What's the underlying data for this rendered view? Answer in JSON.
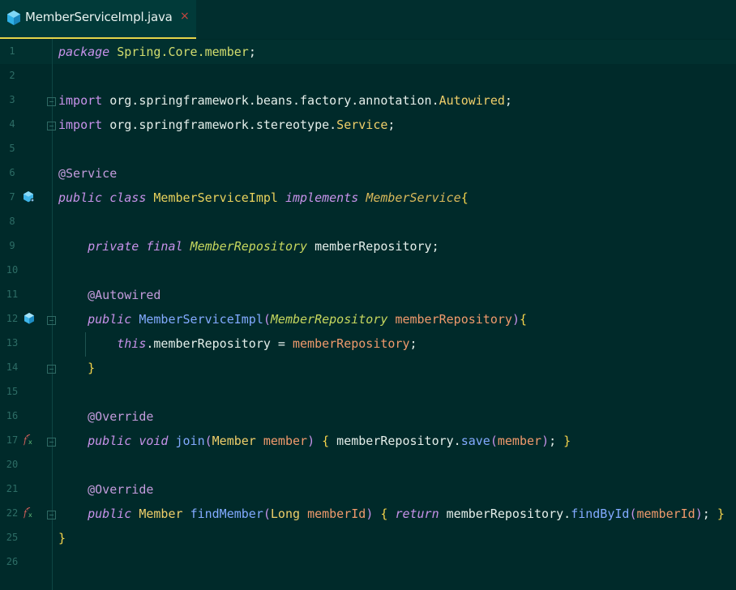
{
  "tab": {
    "title": "MemberServiceImpl.java",
    "close": "×",
    "icon": "java-class-icon"
  },
  "lines": [
    {
      "n": "1",
      "tokens": [
        [
          "kw",
          "package"
        ],
        [
          "pn",
          " "
        ],
        [
          "pk",
          "Spring.Core.member"
        ],
        [
          "pn",
          ";"
        ]
      ]
    },
    {
      "n": "2",
      "tokens": []
    },
    {
      "n": "3",
      "fold": true,
      "tokens": [
        [
          "imp",
          "import"
        ],
        [
          "pn",
          " org.springframework.beans.factory.annotation."
        ],
        [
          "cls",
          "Autowired"
        ],
        [
          "pn",
          ";"
        ]
      ]
    },
    {
      "n": "4",
      "fold": true,
      "tokens": [
        [
          "imp",
          "import"
        ],
        [
          "pn",
          " org.springframework.stereotype."
        ],
        [
          "cls",
          "Service"
        ],
        [
          "pn",
          ";"
        ]
      ]
    },
    {
      "n": "5",
      "tokens": []
    },
    {
      "n": "6",
      "tokens": [
        [
          "an",
          "@Service"
        ]
      ]
    },
    {
      "n": "7",
      "icon": "implementation-icon",
      "tokens": [
        [
          "kw",
          "public"
        ],
        [
          "pn",
          " "
        ],
        [
          "kw",
          "class"
        ],
        [
          "pn",
          " "
        ],
        [
          "yl",
          "MemberServiceImpl"
        ],
        [
          "pn",
          " "
        ],
        [
          "kw",
          "implements"
        ],
        [
          "pn",
          " "
        ],
        [
          "iface",
          "MemberService"
        ],
        [
          "br",
          "{"
        ]
      ]
    },
    {
      "n": "8",
      "tokens": []
    },
    {
      "n": "9",
      "tokens": [
        [
          "pn",
          "    "
        ],
        [
          "kw",
          "private"
        ],
        [
          "pn",
          " "
        ],
        [
          "kw",
          "final"
        ],
        [
          "pn",
          " "
        ],
        [
          "tp",
          "MemberRepository"
        ],
        [
          "pn",
          " memberRepository;"
        ]
      ]
    },
    {
      "n": "10",
      "tokens": []
    },
    {
      "n": "11",
      "tokens": [
        [
          "pn",
          "    "
        ],
        [
          "an",
          "@Autowired"
        ]
      ]
    },
    {
      "n": "12",
      "icon": "bean-icon",
      "fold": true,
      "tokens": [
        [
          "pn",
          "    "
        ],
        [
          "kw",
          "public"
        ],
        [
          "pn",
          " "
        ],
        [
          "fn",
          "MemberServiceImpl"
        ],
        [
          "br2",
          "("
        ],
        [
          "tp",
          "MemberRepository"
        ],
        [
          "pn",
          " "
        ],
        [
          "par",
          "memberRepository"
        ],
        [
          "br2",
          ")"
        ],
        [
          "br",
          "{"
        ]
      ]
    },
    {
      "n": "13",
      "tokens": [
        [
          "pn",
          "        "
        ],
        [
          "kw",
          "this"
        ],
        [
          "pn",
          ".memberRepository = "
        ],
        [
          "par",
          "memberRepository"
        ],
        [
          "pn",
          ";"
        ]
      ]
    },
    {
      "n": "14",
      "fold": true,
      "tokens": [
        [
          "pn",
          "    "
        ],
        [
          "br",
          "}"
        ]
      ]
    },
    {
      "n": "15",
      "tokens": []
    },
    {
      "n": "16",
      "tokens": [
        [
          "pn",
          "    "
        ],
        [
          "an",
          "@Override"
        ]
      ]
    },
    {
      "n": "17",
      "icon": "override-icon",
      "fold": true,
      "tokens": [
        [
          "pn",
          "    "
        ],
        [
          "kw",
          "public"
        ],
        [
          "pn",
          " "
        ],
        [
          "kw",
          "void"
        ],
        [
          "pn",
          " "
        ],
        [
          "fn",
          "join"
        ],
        [
          "br2",
          "("
        ],
        [
          "cls",
          "Member"
        ],
        [
          "pn",
          " "
        ],
        [
          "par",
          "member"
        ],
        [
          "br2",
          ")"
        ],
        [
          "pn",
          " "
        ],
        [
          "br",
          "{"
        ],
        [
          "pn",
          " memberRepository."
        ],
        [
          "fn",
          "save"
        ],
        [
          "br2",
          "("
        ],
        [
          "par",
          "member"
        ],
        [
          "br2",
          ")"
        ],
        [
          "pn",
          ";"
        ],
        [
          "pn",
          " "
        ],
        [
          "br",
          "}"
        ]
      ]
    },
    {
      "n": "20",
      "tokens": []
    },
    {
      "n": "21",
      "tokens": [
        [
          "pn",
          "    "
        ],
        [
          "an",
          "@Override"
        ]
      ]
    },
    {
      "n": "22",
      "icon": "override-icon",
      "fold": true,
      "tokens": [
        [
          "pn",
          "    "
        ],
        [
          "kw",
          "public"
        ],
        [
          "pn",
          " "
        ],
        [
          "cls",
          "Member"
        ],
        [
          "pn",
          " "
        ],
        [
          "fn",
          "findMember"
        ],
        [
          "br2",
          "("
        ],
        [
          "cls",
          "Long"
        ],
        [
          "pn",
          " "
        ],
        [
          "par",
          "memberId"
        ],
        [
          "br2",
          ")"
        ],
        [
          "pn",
          " "
        ],
        [
          "br",
          "{"
        ],
        [
          "pn",
          " "
        ],
        [
          "kw",
          "return"
        ],
        [
          "pn",
          " memberRepository."
        ],
        [
          "fn",
          "findById"
        ],
        [
          "br2",
          "("
        ],
        [
          "par",
          "memberId"
        ],
        [
          "br2",
          ")"
        ],
        [
          "pn",
          ";"
        ],
        [
          "pn",
          " "
        ],
        [
          "br",
          "}"
        ]
      ]
    },
    {
      "n": "25",
      "tokens": [
        [
          "br",
          "}"
        ]
      ]
    },
    {
      "n": "26",
      "tokens": []
    }
  ],
  "colors": {
    "background": "#002a2a",
    "tab_underline": "#e6d54a",
    "keyword": "#c792ea",
    "function": "#82aaff",
    "parameter": "#f09a6c"
  }
}
